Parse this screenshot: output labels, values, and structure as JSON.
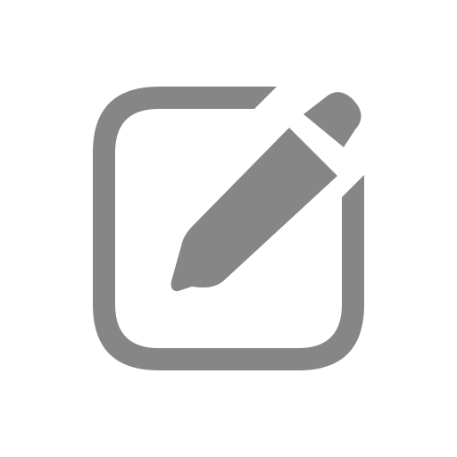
{
  "icon": {
    "name": "edit-icon",
    "color": "#868686",
    "background": "#ffffff"
  }
}
